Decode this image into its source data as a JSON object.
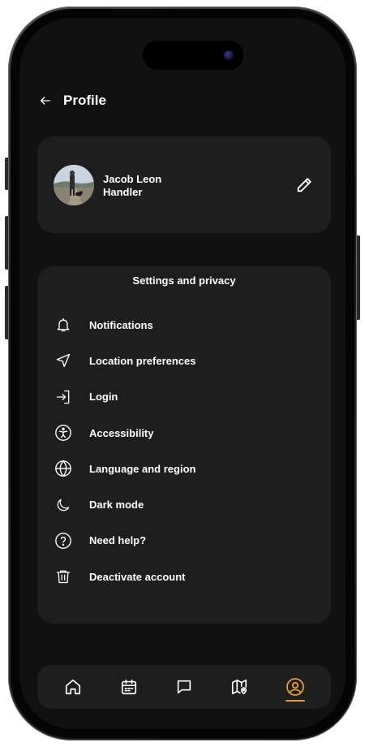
{
  "header": {
    "title": "Profile"
  },
  "profile": {
    "name": "Jacob Leon Handler"
  },
  "settings": {
    "title": "Settings and privacy",
    "items": [
      {
        "label": "Notifications",
        "icon": "bell-icon"
      },
      {
        "label": "Location preferences",
        "icon": "location-arrow-icon"
      },
      {
        "label": "Login",
        "icon": "login-icon"
      },
      {
        "label": "Accessibility",
        "icon": "accessibility-icon"
      },
      {
        "label": "Language and region",
        "icon": "globe-icon"
      },
      {
        "label": "Dark mode",
        "icon": "moon-icon"
      },
      {
        "label": "Need help?",
        "icon": "help-circle-icon"
      },
      {
        "label": "Deactivate account",
        "icon": "trash-icon"
      }
    ]
  },
  "nav": {
    "items": [
      {
        "icon": "home-icon"
      },
      {
        "icon": "calendar-icon"
      },
      {
        "icon": "chat-icon"
      },
      {
        "icon": "map-pin-icon"
      },
      {
        "icon": "user-circle-icon",
        "active": true
      }
    ],
    "accent_color": "#e79a3a"
  },
  "colors": {
    "background": "#111111",
    "card": "#1e1e1e",
    "text": "#ffffff"
  }
}
